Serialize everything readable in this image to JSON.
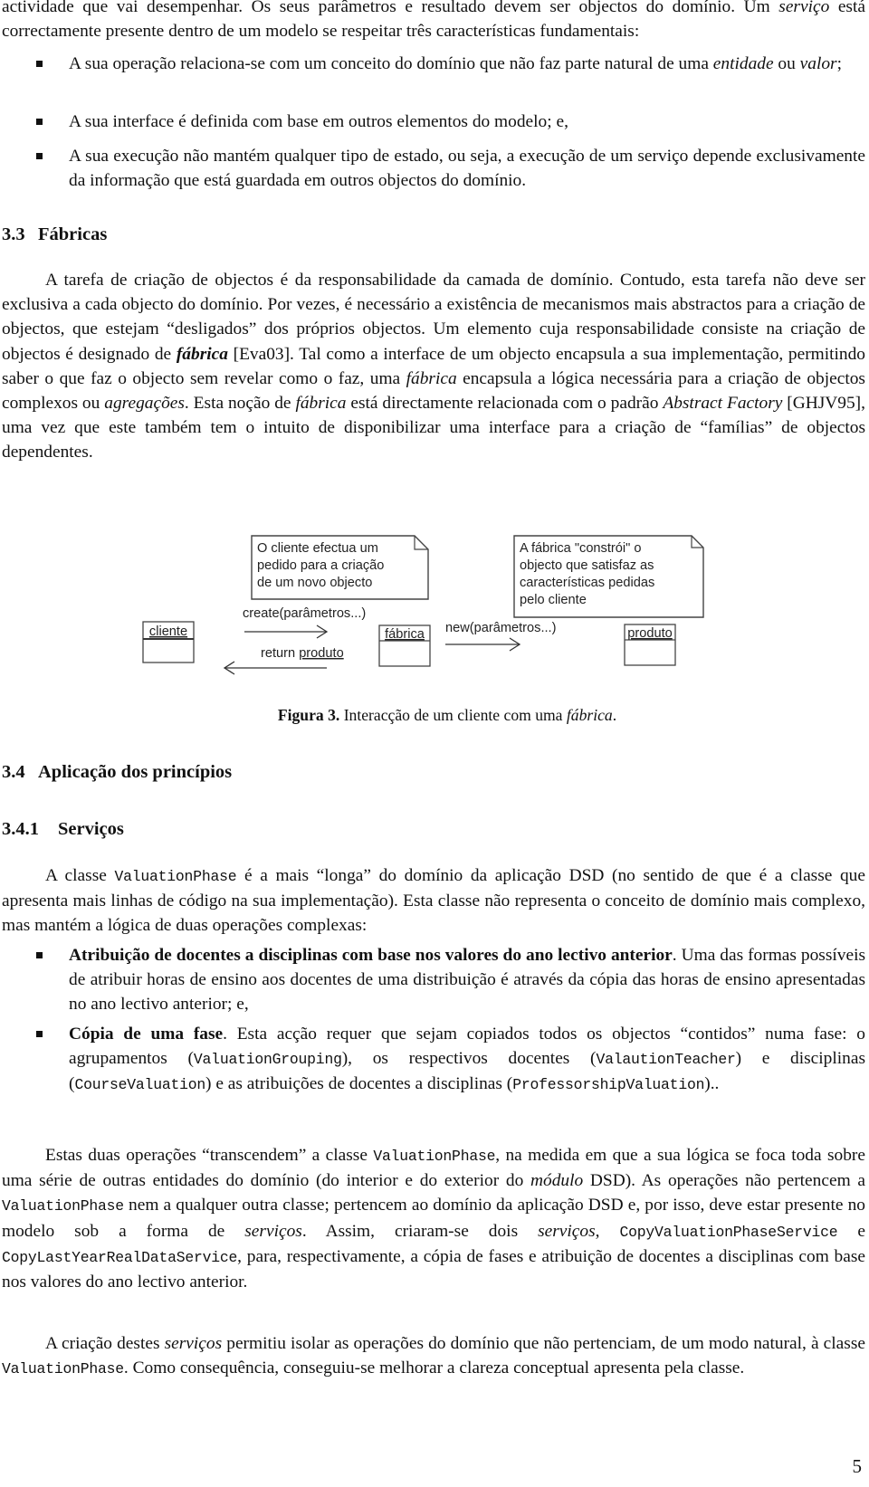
{
  "page": {
    "page_number": "5"
  },
  "intro": {
    "line1": "actividade que vai desempenhar. Os seus parâmetros e resultado devem ser objectos do domínio. Um",
    "servico_em": "serviço",
    "line2_rest": " está correctamente presente dentro de um modelo se respeitar três características fundamentais:"
  },
  "service_characteristics": [
    {
      "text_a": "A sua operação relaciona-se com um conceito do domínio que não faz parte natural de uma ",
      "em1": "entidade",
      "text_b": " ou ",
      "em2": "valor",
      "text_c": ";"
    },
    {
      "text": "A sua interface é definida com base em outros elementos do modelo; e,"
    },
    {
      "text": "A sua execução não mantém qualquer tipo de estado, ou seja, a execução de um serviço depende exclusivamente da informação que está guardada em outros objectos do domínio."
    }
  ],
  "section_3_3": {
    "number": "3.3",
    "title": "Fábricas",
    "paragraph": {
      "t1": "A tarefa de criação de objectos é da responsabilidade da camada de domínio. Contudo, esta tarefa não deve ser exclusiva a cada objecto do domínio. Por vezes, é necessário a existência de mecanismos mais abstractos para a criação de objectos, que estejam “desligados” dos próprios objectos. Um elemento cuja responsabilidade consiste na criação de objectos é designado de ",
      "fabrica_bold_italic": "fábrica",
      "t2": " [Eva03]. Tal como a interface de um objecto encapsula a sua implementação, permitindo saber o que faz o objecto sem revelar como o faz, uma ",
      "fabrica_em1": "fábrica",
      "t3": " encapsula a lógica necessária para a criação de objectos complexos ou ",
      "agregacoes_em": "agregações",
      "t4": ". Esta noção de ",
      "fabrica_em2": "fábrica",
      "t5": " está directamente relacionada com o padrão ",
      "abstract_factory_em": "Abstract Factory",
      "t6": " [GHJV95], uma vez que este também tem o intuito de disponibilizar uma interface para a criação de “famílias” de objectos dependentes."
    }
  },
  "figure_3": {
    "note_left_lines": [
      "O cliente efectua um",
      "pedido para a criação",
      "de um novo objecto"
    ],
    "note_right_lines": [
      "A fábrica \"constrói\" o",
      "objecto que satisfaz as",
      "características pedidas",
      "pelo cliente"
    ],
    "objects": {
      "cliente": "cliente",
      "fabrica": "fábrica",
      "produto": "produto"
    },
    "messages": {
      "create": "create(parâmetros...)",
      "return_prefix": "return ",
      "return_object": "produto",
      "new": "new(parâmetros...)"
    },
    "caption": {
      "label": "Figura 3.",
      "text": " Interacção de um cliente com uma ",
      "em": "fábrica",
      "end": "."
    }
  },
  "section_3_4": {
    "number": "3.4",
    "title": "Aplicação dos princípios"
  },
  "section_3_4_1": {
    "number": "3.4.1",
    "title": "Serviços",
    "para1": {
      "t1": "A classe ",
      "code1": "ValuationPhase",
      "t2": " é a mais “longa” do domínio da aplicação DSD (no sentido de que é a classe que apresenta mais linhas de código na sua implementação). Esta classe não representa o conceito de domínio mais complexo, mas mantém a lógica de duas operações complexas:"
    },
    "operations": [
      {
        "bold": "Atribuição de docentes a disciplinas com base nos valores do ano lectivo anterior",
        "rest": ". Uma das formas possíveis de atribuir horas de ensino aos docentes de uma distribuição é através da cópia das horas de ensino apresentadas no ano lectivo anterior; e,"
      },
      {
        "bold": "Cópia de uma fase",
        "t1": ". Esta acção requer que sejam copiados todos os objectos “contidos” numa fase: o agrupamentos (",
        "code1": "ValuationGrouping",
        "t2": "), os respectivos docentes (",
        "code2": "ValautionTeacher",
        "t3": ") e disciplinas (",
        "code3": "CourseValuation",
        "t4": ") e as atribuições de docentes a disciplinas (",
        "code4": "ProfessorshipValuation",
        "t5": ").."
      }
    ],
    "para2": {
      "t1": "Estas duas operações “transcendem” a classe ",
      "code1": "ValuationPhase",
      "t2": ", na medida em que a sua lógica se foca toda sobre uma série de outras entidades do domínio (do interior e do exterior do ",
      "em1": "módulo",
      "t3": " DSD). As operações não pertencem a ",
      "code2": "ValuationPhase",
      "t4": " nem a qualquer outra classe; pertencem ao domínio da aplicação DSD e, por isso, deve estar presente no modelo sob a forma de ",
      "em2": "serviços",
      "t5": ". Assim, criaram-se dois ",
      "em3": "serviços",
      "t6": ", ",
      "code3": "CopyValuationPhaseService",
      "t7": " e ",
      "code4": "CopyLastYearRealDataService",
      "t8": ", para, respectivamente, a cópia de fases e atribuição de docentes a disciplinas com base nos valores do ano lectivo anterior."
    },
    "para3": {
      "t1": "A criação destes ",
      "em1": "serviços",
      "t2": " permitiu isolar as operações do domínio que não pertenciam, de um modo natural, à classe ",
      "code1": "ValuationPhase",
      "t3": ". Como consequência, conseguiu-se melhorar a clareza conceptual apresenta pela classe."
    }
  }
}
